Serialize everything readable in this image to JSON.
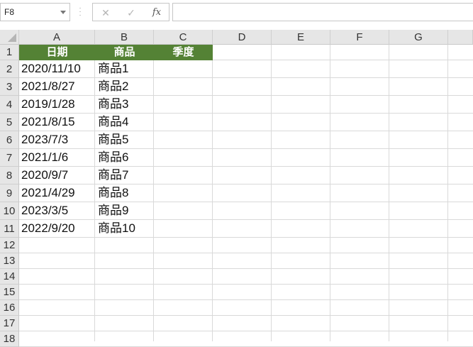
{
  "formula_bar": {
    "name_box": "F8",
    "cancel_icon": "✕",
    "enter_icon": "✓",
    "fx_label": "fx",
    "formula_value": ""
  },
  "columns": [
    "A",
    "B",
    "C",
    "D",
    "E",
    "F",
    "G"
  ],
  "rows": [
    "1",
    "2",
    "3",
    "4",
    "5",
    "6",
    "7",
    "8",
    "9",
    "10",
    "11",
    "12",
    "13",
    "14",
    "15",
    "16",
    "17",
    "18"
  ],
  "header_row": {
    "a": "日期",
    "b": "商品",
    "c": "季度"
  },
  "data_rows": [
    {
      "date": "2020/11/10",
      "product": "商品1"
    },
    {
      "date": "2021/8/27",
      "product": "商品2"
    },
    {
      "date": "2019/1/28",
      "product": "商品3"
    },
    {
      "date": "2021/8/15",
      "product": "商品4"
    },
    {
      "date": "2023/7/3",
      "product": "商品5"
    },
    {
      "date": "2021/1/6",
      "product": "商品6"
    },
    {
      "date": "2020/9/7",
      "product": "商品7"
    },
    {
      "date": "2021/4/29",
      "product": "商品8"
    },
    {
      "date": "2023/3/5",
      "product": "商品9"
    },
    {
      "date": "2022/9/20",
      "product": "商品10"
    }
  ],
  "colors": {
    "header_fill": "#548235",
    "header_text": "#ffffff",
    "grid": "#d9d9d9",
    "headers_bg": "#e6e6e6"
  }
}
